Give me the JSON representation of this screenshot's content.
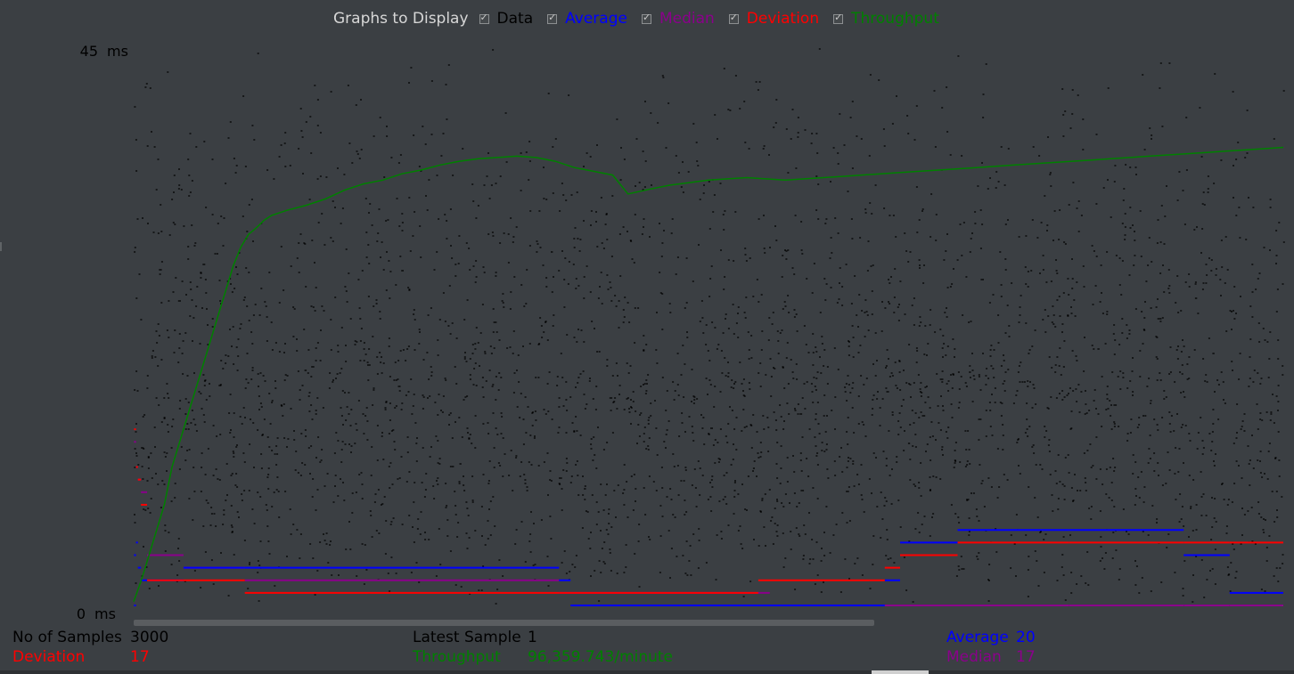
{
  "legend": {
    "title": "Graphs to Display",
    "items": [
      {
        "key": "data",
        "label": "Data",
        "color": "#000000",
        "checked": true
      },
      {
        "key": "average",
        "label": "Average",
        "color": "#0000ff",
        "checked": true
      },
      {
        "key": "median",
        "label": "Median",
        "color": "#8b008b",
        "checked": true
      },
      {
        "key": "deviation",
        "label": "Deviation",
        "color": "#ff0000",
        "checked": true
      },
      {
        "key": "throughput",
        "label": "Throughput",
        "color": "#008000",
        "checked": true
      }
    ]
  },
  "axis": {
    "ymax_label": "45",
    "ymin_label": "0",
    "unit": "ms"
  },
  "stats": {
    "samples_label": "No of Samples",
    "samples_value": "3000",
    "latest_label": "Latest Sample",
    "latest_value": "1",
    "average_label": "Average",
    "average_value": "20",
    "deviation_label": "Deviation",
    "deviation_value": "17",
    "throughput_label": "Throughput",
    "throughput_value": "96,359.743/minute",
    "median_label": "Median",
    "median_value": "17"
  },
  "chart_data": {
    "type": "line",
    "ylim": [
      0,
      45
    ],
    "x_range": [
      0,
      3000
    ],
    "series": [
      {
        "name": "Average",
        "color": "#0000ff",
        "segments": [
          [
            1,
            6,
            0
          ],
          [
            1,
            6,
            4
          ],
          [
            6,
            11,
            5
          ],
          [
            11,
            19,
            3
          ],
          [
            19,
            35,
            2
          ],
          [
            35,
            130,
            2
          ],
          [
            130,
            290,
            3
          ],
          [
            290,
            1110,
            3
          ],
          [
            1110,
            1140,
            2
          ],
          [
            1140,
            1630,
            0
          ],
          [
            1630,
            1920,
            0
          ],
          [
            1920,
            1960,
            0
          ],
          [
            1960,
            2000,
            2
          ],
          [
            2000,
            2150,
            5
          ],
          [
            2150,
            2440,
            6
          ],
          [
            2440,
            2740,
            6
          ],
          [
            2740,
            2860,
            4
          ],
          [
            2860,
            2950,
            1
          ],
          [
            2950,
            3000,
            1
          ]
        ]
      },
      {
        "name": "Median",
        "color": "#8b008b",
        "segments": [
          [
            1,
            6,
            13
          ],
          [
            6,
            11,
            11
          ],
          [
            11,
            19,
            10
          ],
          [
            19,
            35,
            9
          ],
          [
            35,
            130,
            4
          ],
          [
            130,
            290,
            3
          ],
          [
            290,
            1110,
            2
          ],
          [
            1110,
            1660,
            1
          ],
          [
            1660,
            1920,
            0
          ],
          [
            1920,
            1960,
            0
          ],
          [
            1960,
            2000,
            0
          ],
          [
            2000,
            2150,
            0
          ],
          [
            2150,
            2440,
            0
          ],
          [
            2440,
            2740,
            0
          ],
          [
            2740,
            2860,
            0
          ],
          [
            2860,
            2950,
            0
          ],
          [
            2950,
            3000,
            0
          ]
        ]
      },
      {
        "name": "Deviation",
        "color": "#ff0000",
        "segments": [
          [
            1,
            6,
            14
          ],
          [
            6,
            11,
            11
          ],
          [
            11,
            19,
            10
          ],
          [
            19,
            35,
            8
          ],
          [
            35,
            130,
            2
          ],
          [
            130,
            290,
            2
          ],
          [
            290,
            1110,
            1
          ],
          [
            1110,
            1630,
            1
          ],
          [
            1630,
            1920,
            2
          ],
          [
            1920,
            1960,
            2
          ],
          [
            1960,
            2000,
            3
          ],
          [
            2000,
            2150,
            4
          ],
          [
            2150,
            2440,
            5
          ],
          [
            2440,
            2740,
            5
          ],
          [
            2740,
            2860,
            5
          ],
          [
            2860,
            2950,
            5
          ],
          [
            2950,
            3000,
            5
          ]
        ]
      }
    ],
    "throughput_polyline": [
      [
        0,
        0.3
      ],
      [
        20,
        2
      ],
      [
        40,
        4
      ],
      [
        60,
        6
      ],
      [
        80,
        8
      ],
      [
        100,
        11
      ],
      [
        120,
        13
      ],
      [
        140,
        15
      ],
      [
        160,
        17
      ],
      [
        180,
        19
      ],
      [
        200,
        21
      ],
      [
        220,
        23
      ],
      [
        240,
        25
      ],
      [
        260,
        27
      ],
      [
        280,
        28.5
      ],
      [
        300,
        29.5
      ],
      [
        320,
        30
      ],
      [
        340,
        30.6
      ],
      [
        360,
        31
      ],
      [
        400,
        31.4
      ],
      [
        450,
        31.8
      ],
      [
        500,
        32.3
      ],
      [
        550,
        33
      ],
      [
        600,
        33.5
      ],
      [
        650,
        33.8
      ],
      [
        700,
        34.3
      ],
      [
        750,
        34.6
      ],
      [
        800,
        35
      ],
      [
        850,
        35.3
      ],
      [
        900,
        35.5
      ],
      [
        950,
        35.6
      ],
      [
        1000,
        35.7
      ],
      [
        1050,
        35.6
      ],
      [
        1100,
        35.3
      ],
      [
        1150,
        34.8
      ],
      [
        1200,
        34.5
      ],
      [
        1250,
        34.2
      ],
      [
        1290,
        32.7
      ],
      [
        1350,
        33.1
      ],
      [
        1400,
        33.4
      ],
      [
        1450,
        33.6
      ],
      [
        1500,
        33.8
      ],
      [
        1550,
        33.9
      ],
      [
        1600,
        34.0
      ],
      [
        1650,
        33.9
      ],
      [
        1700,
        33.8
      ],
      [
        1750,
        33.9
      ],
      [
        1800,
        34.0
      ],
      [
        1850,
        34.1
      ],
      [
        1900,
        34.2
      ],
      [
        1950,
        34.3
      ],
      [
        2000,
        34.4
      ],
      [
        2050,
        34.5
      ],
      [
        2100,
        34.6
      ],
      [
        2150,
        34.7
      ],
      [
        2200,
        34.8
      ],
      [
        2250,
        34.9
      ],
      [
        2300,
        35.0
      ],
      [
        2350,
        35.1
      ],
      [
        2400,
        35.2
      ],
      [
        2450,
        35.3
      ],
      [
        2500,
        35.4
      ],
      [
        2550,
        35.5
      ],
      [
        2600,
        35.6
      ],
      [
        2650,
        35.7
      ],
      [
        2700,
        35.8
      ],
      [
        2750,
        35.9
      ],
      [
        2800,
        36.0
      ],
      [
        2850,
        36.1
      ],
      [
        2900,
        36.2
      ],
      [
        2950,
        36.3
      ],
      [
        3000,
        36.4
      ]
    ]
  }
}
